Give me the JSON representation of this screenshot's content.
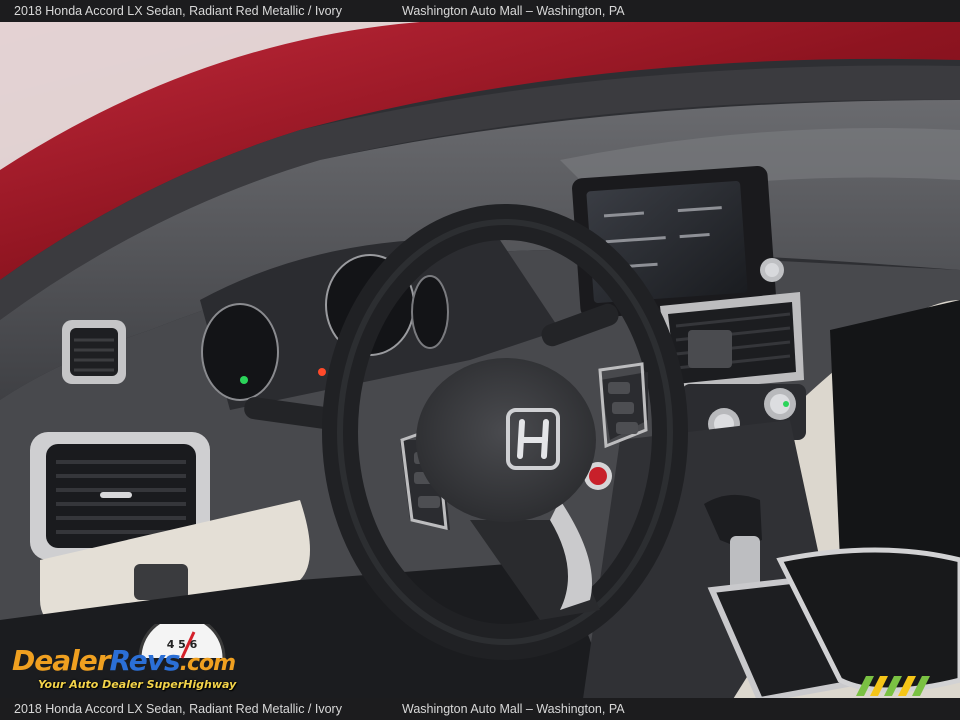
{
  "caption": {
    "vehicle": "2018 Honda Accord LX Sedan,  Radiant Red Metallic / Ivory",
    "dealer": "Washington Auto Mall – Washington, PA"
  },
  "watermark": {
    "brand_part1": "Dealer",
    "brand_part2": "Revs",
    "brand_part3": ".com",
    "tagline": "Your Auto Dealer SuperHighway",
    "gauge_digits": "4 5 6"
  },
  "dealer_badge": {
    "icon": "washington-auto-mall-logo-icon"
  },
  "photo": {
    "subject": "steering-wheel-and-dashboard",
    "colors": {
      "exterior": "#a01828",
      "dash": "#4a4b4f",
      "trim": "#e6e1d8",
      "chrome": "#c9c9c9"
    }
  }
}
